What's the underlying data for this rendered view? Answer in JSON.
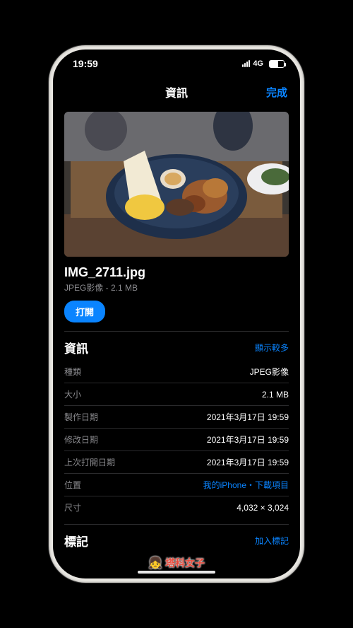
{
  "status": {
    "time": "19:59",
    "network": "4G"
  },
  "nav": {
    "title": "資訊",
    "done": "完成"
  },
  "file": {
    "name": "IMG_2711.jpg",
    "subtitle": "JPEG影像 - 2.1 MB",
    "open_label": "打開"
  },
  "info_section": {
    "title": "資訊",
    "more": "顯示較多",
    "rows": [
      {
        "label": "種類",
        "value": "JPEG影像",
        "link": false
      },
      {
        "label": "大小",
        "value": "2.1 MB",
        "link": false
      },
      {
        "label": "製作日期",
        "value": "2021年3月17日 19:59",
        "link": false
      },
      {
        "label": "修改日期",
        "value": "2021年3月17日 19:59",
        "link": false
      },
      {
        "label": "上次打開日期",
        "value": "2021年3月17日 19:59",
        "link": false
      },
      {
        "label": "位置",
        "value": "我的iPhone・下載項目",
        "link": true
      },
      {
        "label": "尺寸",
        "value": "4,032 × 3,024",
        "link": false
      }
    ]
  },
  "tags_section": {
    "title": "標記",
    "add": "加入標記"
  },
  "watermark": {
    "text": "塔科女子",
    "emoji": "👧"
  }
}
